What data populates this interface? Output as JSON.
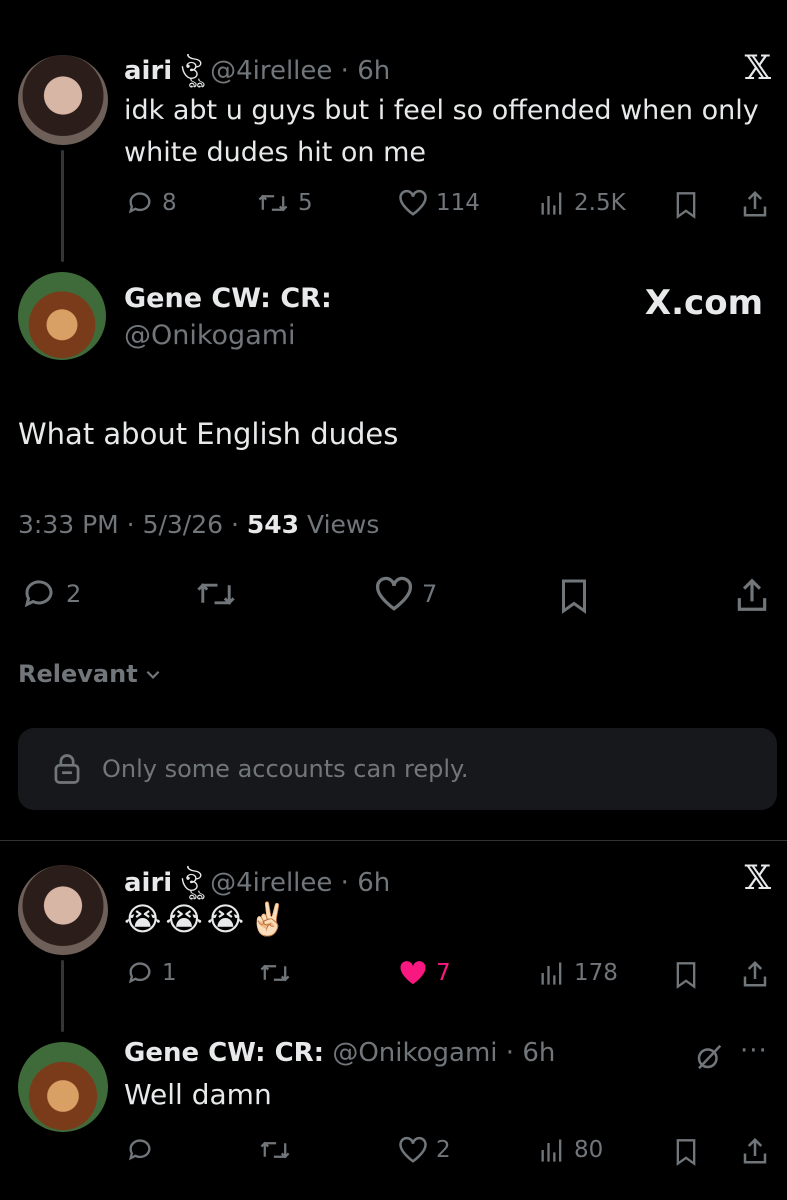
{
  "tweet1": {
    "name": "airi",
    "name_glyph": "ঔৣ",
    "handle_time": "@4irellee · 6h",
    "text_line1": "idk abt u guys but i feel so offended when only",
    "text_line2": "white dudes hit on me",
    "replies": "8",
    "retweets": "5",
    "likes": "114",
    "views": "2.5K"
  },
  "main": {
    "name": "Gene CW: CR:",
    "handle": "@Onikogami",
    "brand": "X.com",
    "text": "What about English dudes",
    "time_date": "3:33 PM · 5/3/26 · ",
    "views_count": "543",
    "views_label": " Views",
    "replies": "2",
    "likes": "7"
  },
  "sort": {
    "label": "Relevant"
  },
  "reply_notice": {
    "text": "Only some accounts can reply."
  },
  "tweet2": {
    "name": "airi",
    "name_glyph": "ঔৣ",
    "handle_time": "@4irellee · 6h",
    "emoji_text": "😭😭😭✌🏻",
    "replies": "1",
    "likes": "7",
    "views": "178"
  },
  "tweet3": {
    "name": "Gene CW: CR:",
    "handle_time": "@Onikogami · 6h",
    "text": "Well damn",
    "likes": "2",
    "views": "80"
  },
  "colors": {
    "background": "#000000",
    "text": "#e7e9ea",
    "muted": "#71767b",
    "like_pink": "#f91880",
    "notice_bg": "#16181c"
  }
}
